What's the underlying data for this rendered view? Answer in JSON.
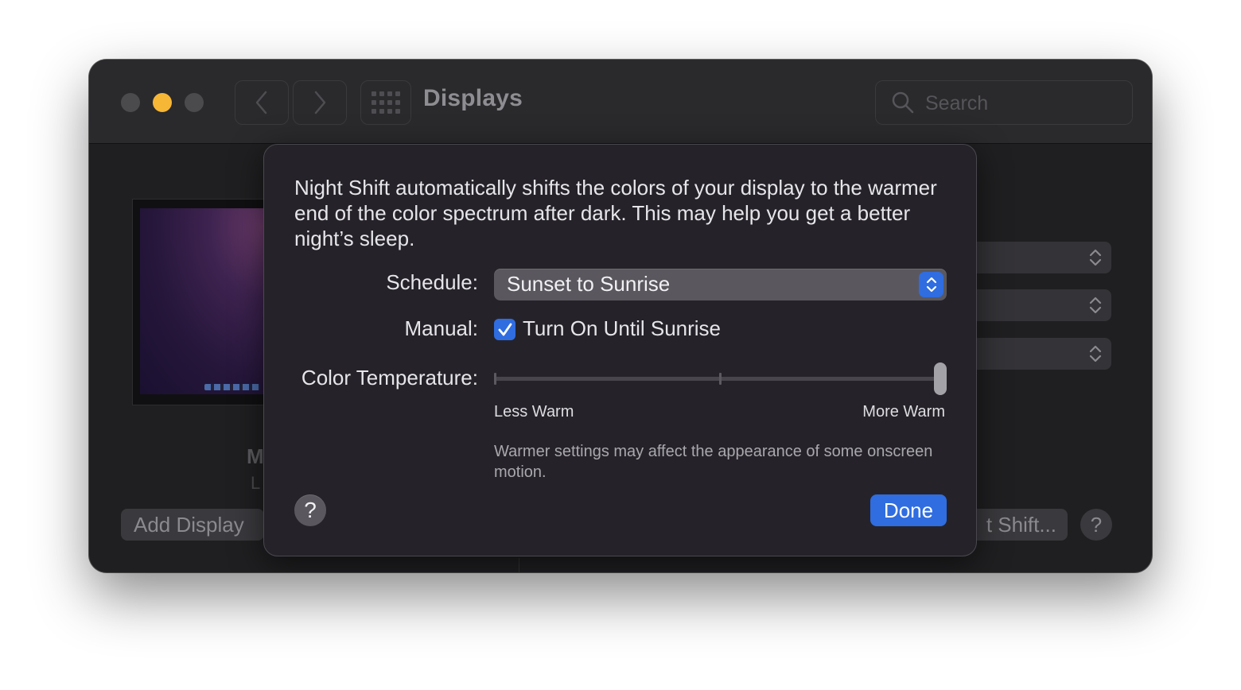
{
  "window": {
    "title": "Displays",
    "search_placeholder": "Search"
  },
  "background": {
    "display_name_partial": "M",
    "display_sub_partial": "L",
    "add_display_label": "Add Display",
    "night_shift_button_partial": "t Shift...",
    "help_label": "?"
  },
  "sheet": {
    "description": "Night Shift automatically shifts the colors of your display to the warmer end of the color spectrum after dark. This may help you get a better night’s sleep.",
    "schedule_label": "Schedule:",
    "schedule_value": "Sunset to Sunrise",
    "manual_label": "Manual:",
    "manual_checkbox_label": "Turn On Until Sunrise",
    "manual_checked": true,
    "color_temp_label": "Color Temperature:",
    "slider_min_label": "Less Warm",
    "slider_max_label": "More Warm",
    "slider_value": 1.0,
    "note": "Warmer settings may affect the appearance of some onscreen motion.",
    "help_label": "?",
    "done_label": "Done"
  },
  "colors": {
    "accent": "#2f6de0",
    "minimize": "#f6b636"
  },
  "icons": [
    "chevron-left-icon",
    "chevron-right-icon",
    "grid-icon",
    "search-icon",
    "up-down-chevron-icon",
    "checkmark-icon"
  ]
}
